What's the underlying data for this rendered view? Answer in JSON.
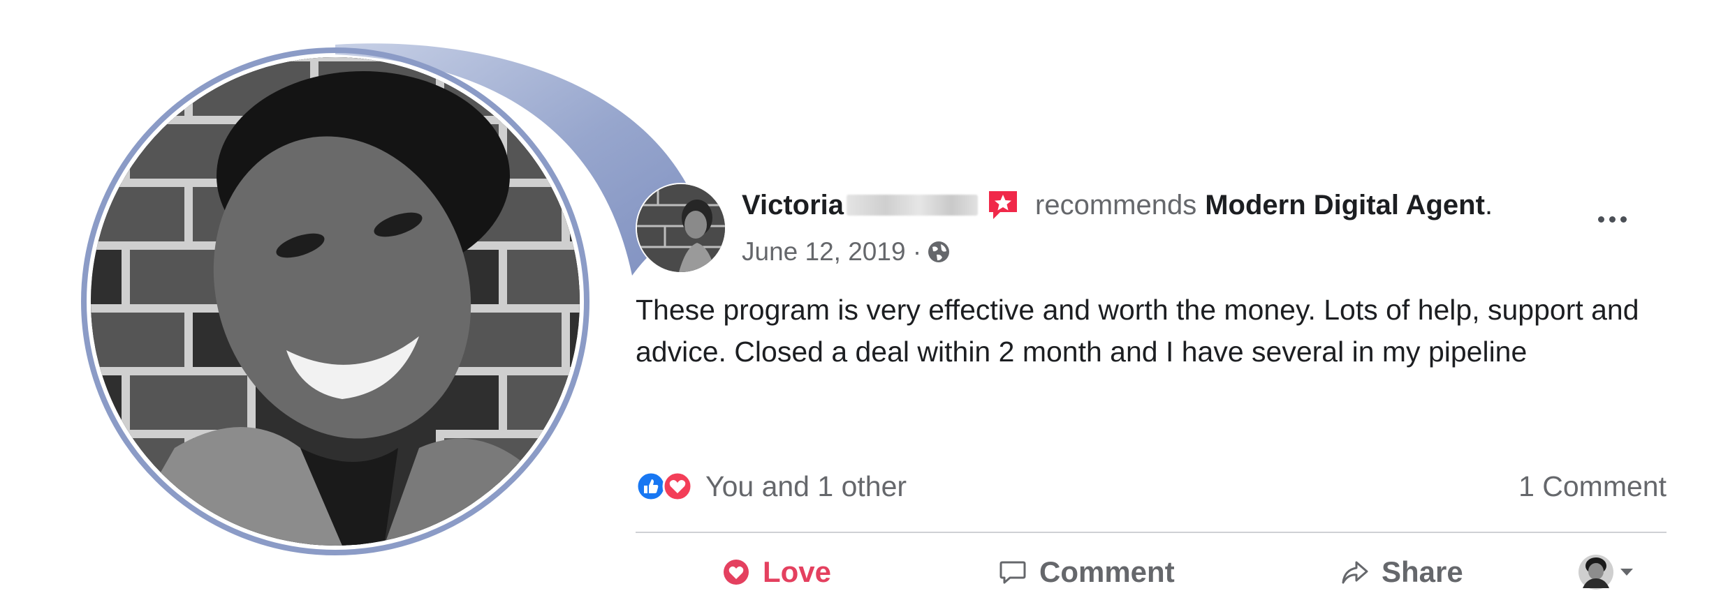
{
  "post": {
    "author_name": "Victoria",
    "recommends_text": "recommends",
    "page_name": "Modern Digital Agent",
    "page_name_suffix": ".",
    "date": "June 12, 2019 ·",
    "body": "These program is very effective and worth the money. Lots of help, support and advice. Closed a deal  within 2 month and I have several in my pipeline"
  },
  "engagement": {
    "reaction_summary": "You and 1 other",
    "comment_count": "1 Comment"
  },
  "actions": {
    "love_label": "Love",
    "comment_label": "Comment",
    "share_label": "Share"
  },
  "icons": {
    "recommend_badge": "star-badge-icon",
    "audience": "globe-icon",
    "like_reaction": "like-reaction-icon",
    "love_reaction": "love-reaction-icon",
    "more": "more-options-icon",
    "love_action": "heart-outline-icon",
    "comment_action": "comment-bubble-icon",
    "share_action": "share-arrow-icon",
    "audience_selector": "caret-down-icon"
  },
  "colors": {
    "love_red": "#e4405f",
    "like_blue": "#1877f2",
    "badge_red": "#f02849",
    "bubble_blue": "#8b9bc6",
    "muted_text": "#65676b"
  }
}
